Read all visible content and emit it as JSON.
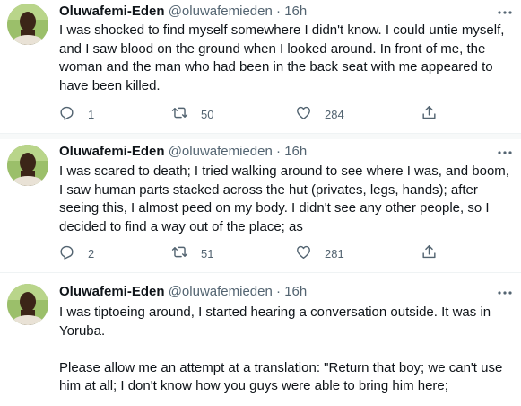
{
  "tweets": [
    {
      "name": "Oluwafemi-Eden",
      "handle": "@oluwafemieden",
      "dot": "·",
      "time": "16h",
      "text": "I was shocked to find myself somewhere I didn't know. I could untie myself, and I saw blood on the ground when I looked around. In front of me, the woman and the man who had been in the back seat with me appeared to have been killed.",
      "replies": "1",
      "retweets": "50",
      "likes": "284"
    },
    {
      "name": "Oluwafemi-Eden",
      "handle": "@oluwafemieden",
      "dot": "·",
      "time": "16h",
      "text": "I was scared to death; I tried walking around to see where I was, and boom, I saw human parts stacked across the hut (privates, legs, hands); after seeing this, I almost peed on my body. I didn't see any other people, so I decided to find a way out of the place; as",
      "replies": "2",
      "retweets": "51",
      "likes": "281"
    },
    {
      "name": "Oluwafemi-Eden",
      "handle": "@oluwafemieden",
      "dot": "·",
      "time": "16h",
      "text": "I was tiptoeing around, I started hearing a conversation outside. It was in Yoruba.\n\nPlease allow me an attempt at a translation: \"Return that boy; we can't use him at all; I don't know how you guys were able to bring him here;"
    }
  ],
  "icons": {
    "reply": "reply-icon",
    "retweet": "retweet-icon",
    "like": "heart-icon",
    "share": "share-icon",
    "more": "more-icon"
  }
}
